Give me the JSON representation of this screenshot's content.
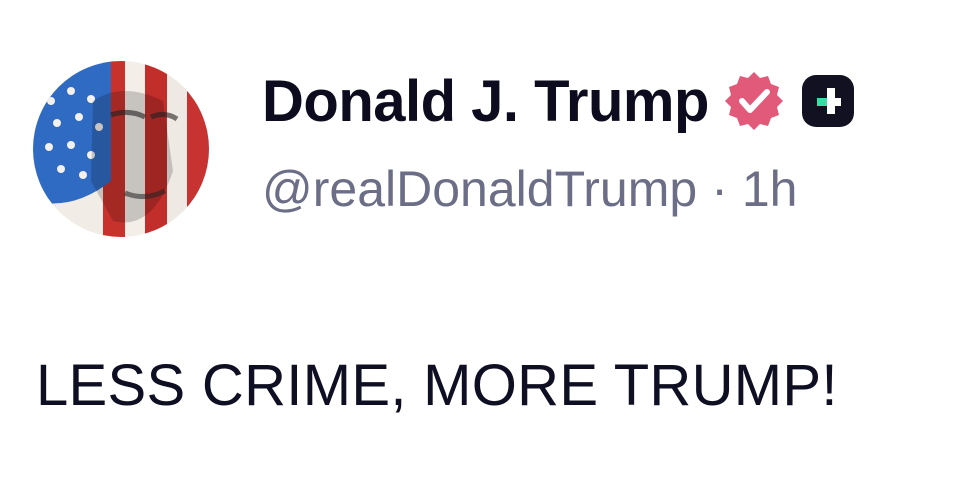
{
  "author": {
    "display_name": "Donald J. Trump",
    "handle": "@realDonaldTrump",
    "separator": "·",
    "timestamp": "1h",
    "verified_badge_icon": "verified-check-icon",
    "verified_badge_color": "#e25a7a",
    "platform_badge_icon": "truth-social-icon",
    "platform_badge_color": "#111122",
    "platform_badge_accent": "#35e0a6"
  },
  "post": {
    "text": "LESS CRIME, MORE TRUMP!"
  }
}
